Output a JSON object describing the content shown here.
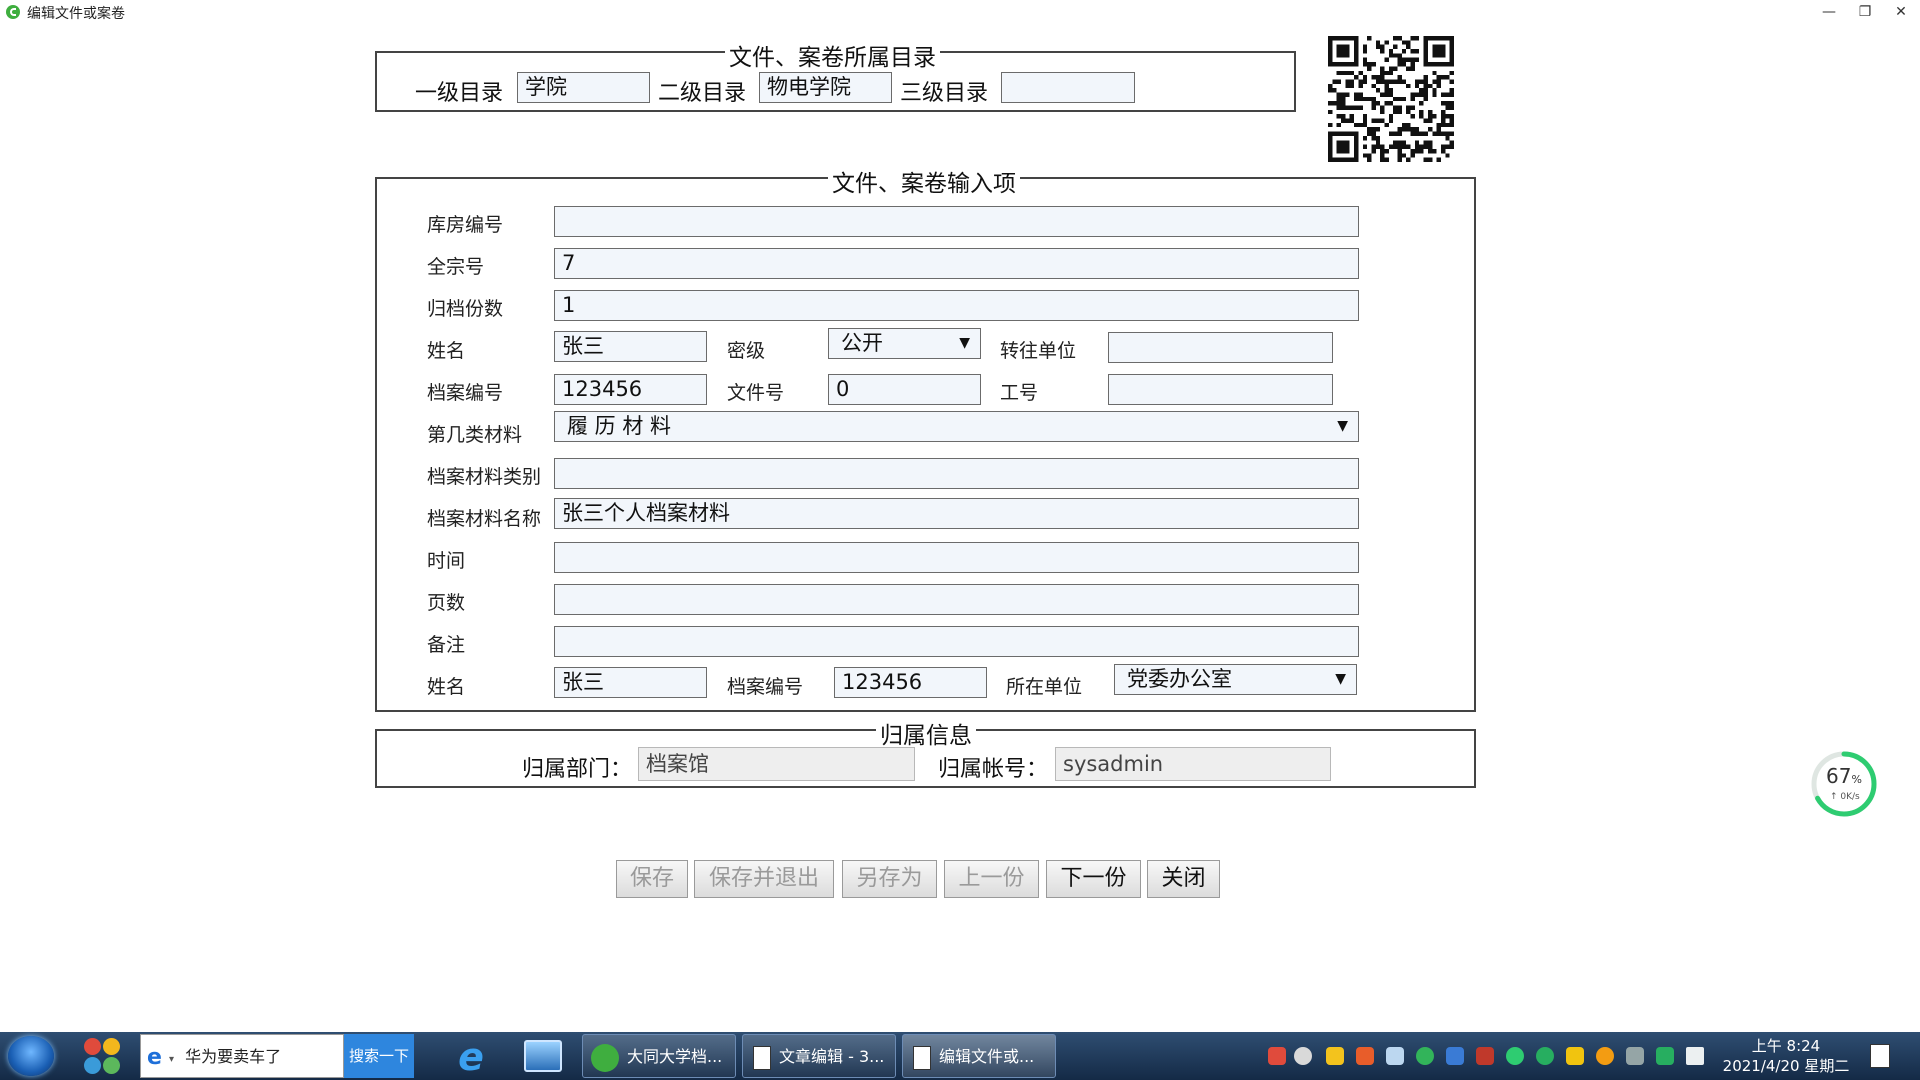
{
  "window": {
    "title": "编辑文件或案卷",
    "minimize": "—",
    "restore": "❐",
    "close": "✕"
  },
  "catalog": {
    "legend": "文件、案卷所属目录",
    "level1_label": "一级目录",
    "level1_value": "学院",
    "level2_label": "二级目录",
    "level2_value": "物电学院",
    "level3_label": "三级目录",
    "level3_value": ""
  },
  "form": {
    "legend": "文件、案卷输入项",
    "warehouse_no_label": "库房编号",
    "warehouse_no_value": "",
    "fonds_no_label": "全宗号",
    "fonds_no_value": "7",
    "copies_label": "归档份数",
    "copies_value": "1",
    "name_label": "姓名",
    "name_value": "张三",
    "secret_label": "密级",
    "secret_value": "公开",
    "transfer_unit_label": "转往单位",
    "transfer_unit_value": "",
    "archive_no_label": "档案编号",
    "archive_no_value": "123456",
    "file_no_label": "文件号",
    "file_no_value": "0",
    "work_no_label": "工号",
    "work_no_value": "",
    "material_class_label": "第几类材料",
    "material_class_value": "履 历 材 料",
    "material_category_label": "档案材料类别",
    "material_category_value": "",
    "material_name_label": "档案材料名称",
    "material_name_value": "张三个人档案材料",
    "time_label": "时间",
    "time_value": "",
    "pages_label": "页数",
    "pages_value": "",
    "remark_label": "备注",
    "remark_value": "",
    "name2_label": "姓名",
    "name2_value": "张三",
    "archive_no2_label": "档案编号",
    "archive_no2_value": "123456",
    "unit_label": "所在单位",
    "unit_value": "党委办公室"
  },
  "owner": {
    "legend": "归属信息",
    "dept_label": "归属部门：",
    "dept_value": "档案馆",
    "account_label": "归属帐号：",
    "account_value": "sysadmin"
  },
  "buttons": {
    "save": "保存",
    "save_exit": "保存并退出",
    "save_as": "另存为",
    "prev": "上一份",
    "next": "下一份",
    "close": "关闭"
  },
  "speed_widget": {
    "percent": "67",
    "percent_unit": "%",
    "rate": "↑ 0K/s"
  },
  "taskbar": {
    "ie_search_text": "华为要卖车了",
    "search_button": "搜索一下",
    "win1": "大同大学档...",
    "win2": "文章编辑 - 3...",
    "win3": "编辑文件或...",
    "clock_time": "上午 8:24",
    "clock_date": "2021/4/20 星期二"
  },
  "colors": {
    "taskbar": "#1c3556",
    "search_button": "#2e86de",
    "progress": "#2ecc71"
  }
}
